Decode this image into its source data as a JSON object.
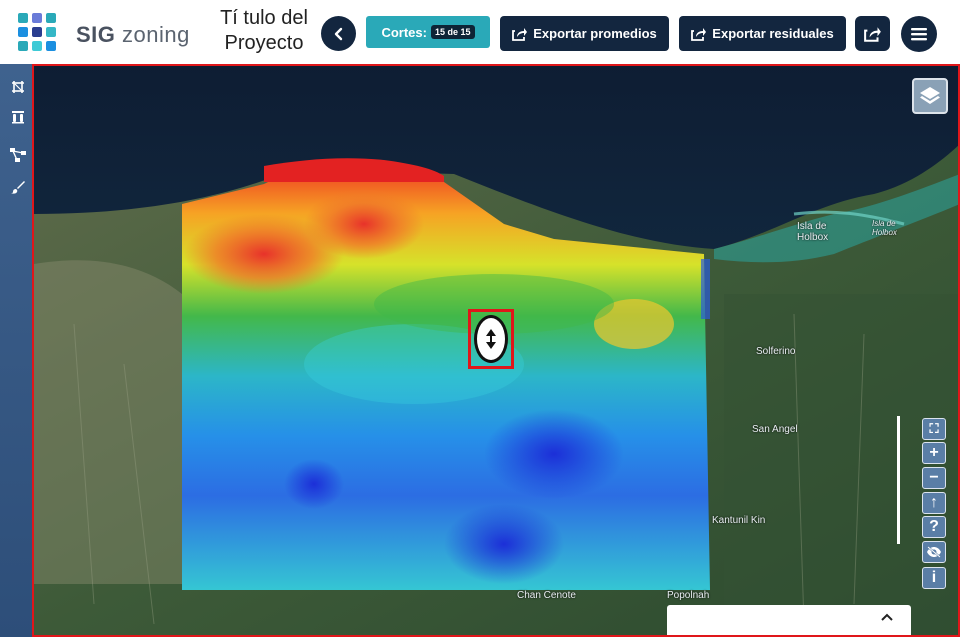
{
  "app": {
    "logo_main": "SIG",
    "logo_sub": "zoning",
    "project_title_line1": "Tí tulo del",
    "project_title_line2": "Proyecto"
  },
  "toolbar": {
    "cortes_label": "Cortes:",
    "cortes_badge": "15 de 15",
    "export_promedios_label": "Exportar promedios",
    "export_residuales_label": "Exportar residuales"
  },
  "sidebar": {
    "tools": [
      {
        "icon": "crop-icon"
      },
      {
        "icon": "flask-icon"
      },
      {
        "icon": "network-icon"
      },
      {
        "icon": "brush-icon"
      }
    ]
  },
  "map": {
    "labels": {
      "isla_holbox_1": "Isla de",
      "isla_holbox_2": "Holbox",
      "isla_holbox_italic_1": "Isla de",
      "isla_holbox_italic_2": "Holbox",
      "solferino": "Solferino",
      "san_angel": "San Angel",
      "kantunil_kin": "Kantunil Kin",
      "chan_cenote": "Chan Cenote",
      "popolnah": "Popolnah"
    },
    "controls": {
      "fullscreen": "⛶",
      "zoom_in": "+",
      "zoom_out": "−",
      "up": "↑",
      "help": "?",
      "hide": "👁",
      "info": "i"
    }
  },
  "colors": {
    "navy": "#13263f",
    "teal": "#2aa9b8",
    "highlight_red": "#e0161a",
    "sidebar": "#3f628e"
  }
}
